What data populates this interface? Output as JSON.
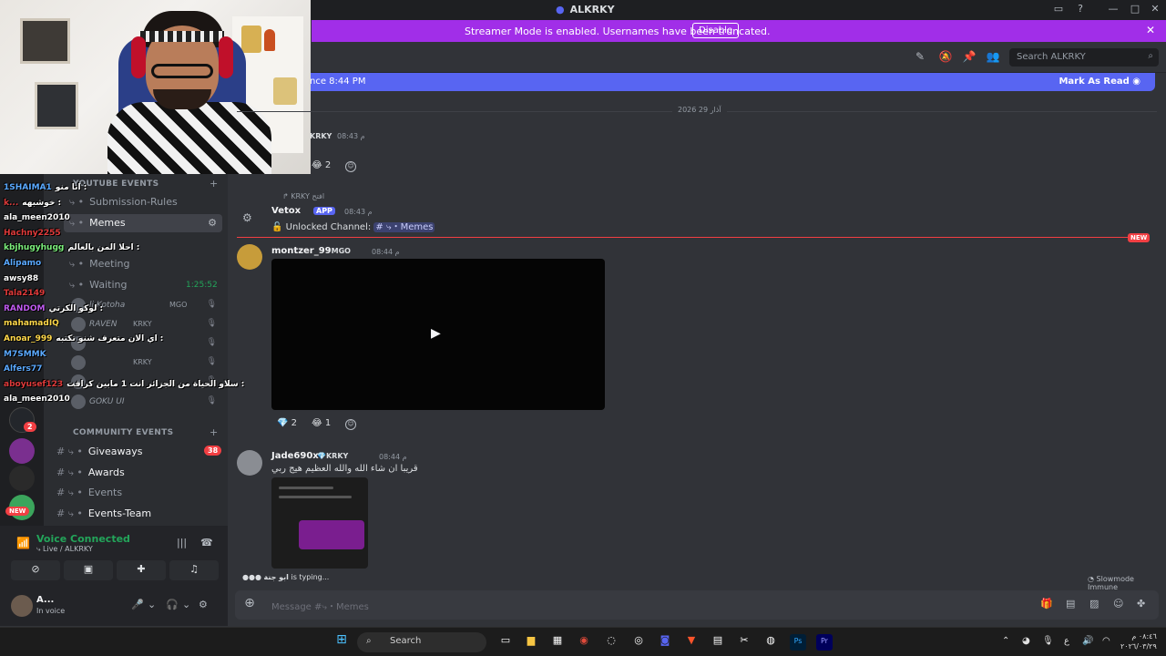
{
  "window": {
    "title": "ALKRKY"
  },
  "banner": {
    "message": "Streamer Mode is enabled. Usernames have been truncated.",
    "disable_label": "Disable"
  },
  "header": {
    "search_placeholder": "Search ALKRKY"
  },
  "newbar": {
    "since": "nce 8:44 PM",
    "mark_read": "Mark As Read"
  },
  "sidebar": {
    "category_youtube": "YOUTUBE EVENTS",
    "category_community": "COMMUNITY EVENTS",
    "channels": [
      {
        "label": "Submission-Rules"
      },
      {
        "label": "Memes"
      },
      {
        "label": "Meeting"
      },
      {
        "label": "Waiting"
      },
      {
        "label": "Giveaways",
        "badge": "38"
      },
      {
        "label": "Awards"
      },
      {
        "label": "Events"
      },
      {
        "label": "Events-Team"
      }
    ],
    "waiting_timer": "1:25:52",
    "voice_users": [
      {
        "name": "li Kotoha",
        "tag": "MGO"
      },
      {
        "name": "RAVEN",
        "tag": "KRKY"
      },
      {
        "name": "",
        "tag": ""
      },
      {
        "name": "",
        "tag": "KRKY"
      },
      {
        "name": "",
        "tag": ""
      },
      {
        "name": "GOKU UI",
        "tag": ""
      }
    ],
    "guild_badges": [
      "2",
      "NEW"
    ]
  },
  "overlay_chat": [
    {
      "user": "1SHAIMA1",
      "text": "انا منو :",
      "color": "#5aa9ff"
    },
    {
      "user": "k...",
      "text": "خوشبهه :",
      "color": "#e03a3a"
    },
    {
      "user": "ala_meen2010",
      "text": "",
      "color": "#ffffff"
    },
    {
      "user": "Hachny2255",
      "text": "",
      "color": "#e03a3a"
    },
    {
      "user": "kbjhugyhugg",
      "text": "احلا المن بالعالم :",
      "color": "#7cf07c"
    },
    {
      "user": "Alipamo",
      "text": "",
      "color": "#5aa9ff"
    },
    {
      "user": "awsy88",
      "text": "",
      "color": "#ffffff"
    },
    {
      "user": "Tala2149",
      "text": "",
      "color": "#e03a3a"
    },
    {
      "user": "RANDOM",
      "text": "لوكو الكرتي :",
      "color": "#c05af0"
    },
    {
      "user": "mahamadIQ",
      "text": "",
      "color": "#ffd84a"
    },
    {
      "user": "Anoar_999",
      "text": "اي الان متعرف شنو تكتبه :",
      "color": "#ffd84a"
    },
    {
      "user": "M7SMMK",
      "text": "",
      "color": "#5aa9ff"
    },
    {
      "user": "Alfers77",
      "text": "",
      "color": "#5aa9ff"
    },
    {
      "user": "aboyusef123",
      "text": "سلاو الحياة من الجزائر انت 1 مابين كرافت :",
      "color": "#e03a3a"
    },
    {
      "user": "ala_meen2010",
      "text": "",
      "color": "#ffffff"
    }
  ],
  "chat": {
    "date_divider": "آذار 29 2026",
    "messages": [
      {
        "user": "KRKY",
        "time": "08:43 م",
        "reactions": [
          {
            "emoji": "😂",
            "count": "2"
          }
        ]
      },
      {
        "user": "Vetox",
        "app_label": "APP",
        "time": "08:43 م",
        "reply_tag": "KRKY",
        "reply_text": "افتح",
        "body_prefix": "Unlocked Channel:",
        "channel_ref": "# ⤷・Memes"
      },
      {
        "user": "montzer_99",
        "tag": "MGO",
        "time": "08:44 م",
        "reactions": [
          {
            "emoji": "💎",
            "count": "2"
          },
          {
            "emoji": "😂",
            "count": "1"
          }
        ]
      },
      {
        "user": "Jade690x",
        "tag": "KRKY",
        "time": "08:44 م",
        "text": "قريبا ان شاء الله والله العظيم هيج ربي"
      }
    ],
    "new_label": "NEW"
  },
  "typing": {
    "user": "ابو جنة",
    "text": "is typing..."
  },
  "slowmode": "Slowmode Immune",
  "composer": {
    "placeholder": "Message #⤷・Memes"
  },
  "voice_panel": {
    "status": "Voice Connected",
    "channel": "⤷ Live / ALKRKY"
  },
  "user_panel": {
    "name": "A...",
    "status": "In voice"
  },
  "taskbar": {
    "search_label": "Search",
    "time": "٠٨:٤٦ م",
    "date": "٢٠٢٦/٠٣/٢٩",
    "lang": "ع"
  },
  "colors": {
    "accent": "#5865f2",
    "streamer_banner": "#a12ee8",
    "online": "#23a55a",
    "danger": "#f23f43"
  }
}
